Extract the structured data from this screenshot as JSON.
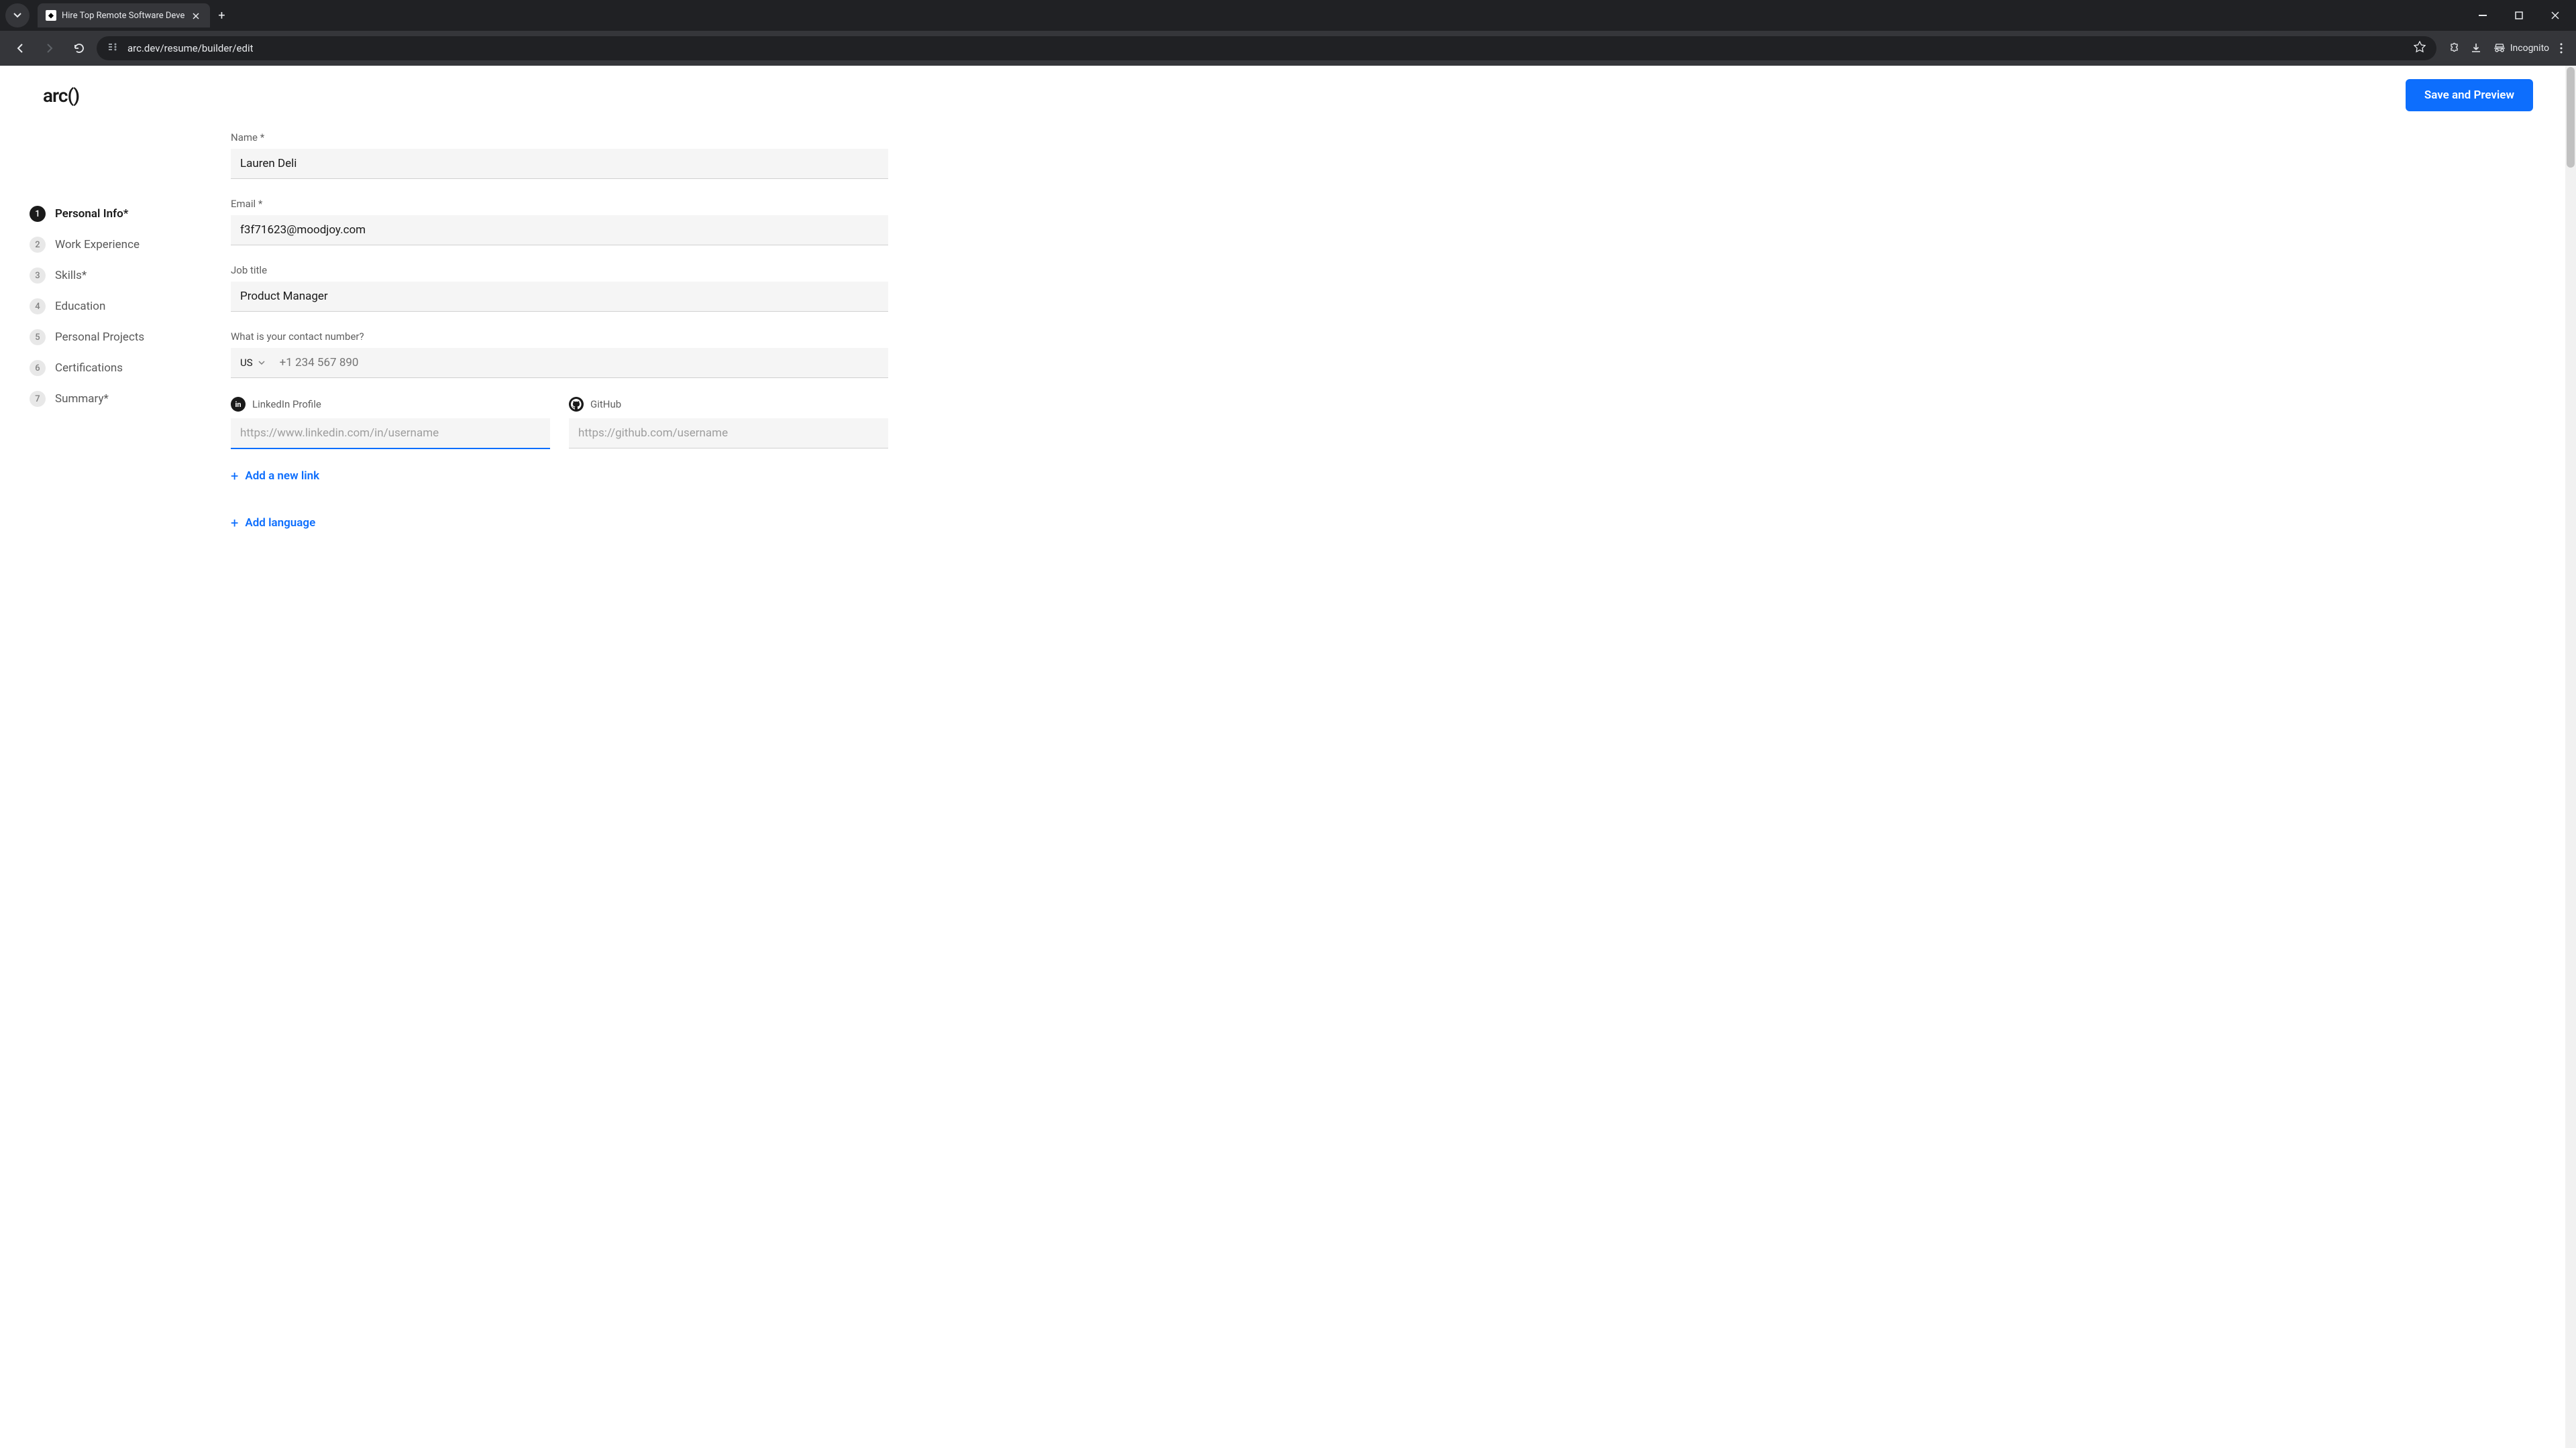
{
  "browser": {
    "tab_title": "Hire Top Remote Software Deve",
    "url": "arc.dev/resume/builder/edit",
    "incognito_label": "Incognito"
  },
  "header": {
    "logo": "arc()",
    "save_button": "Save and Preview"
  },
  "sidebar": {
    "steps": [
      {
        "num": "1",
        "label": "Personal Info*",
        "active": true
      },
      {
        "num": "2",
        "label": "Work Experience",
        "active": false
      },
      {
        "num": "3",
        "label": "Skills*",
        "active": false
      },
      {
        "num": "4",
        "label": "Education",
        "active": false
      },
      {
        "num": "5",
        "label": "Personal Projects",
        "active": false
      },
      {
        "num": "6",
        "label": "Certifications",
        "active": false
      },
      {
        "num": "7",
        "label": "Summary*",
        "active": false
      }
    ]
  },
  "form": {
    "name_label": "Name *",
    "name_value": "Lauren Deli",
    "email_label": "Email *",
    "email_value": "f3f71623@moodjoy.com",
    "jobtitle_label": "Job title",
    "jobtitle_value": "Product Manager",
    "phone_label": "What is your contact number?",
    "phone_country": "US",
    "phone_placeholder": "+1 234 567 890",
    "linkedin_label": "LinkedIn Profile",
    "linkedin_placeholder": "https://www.linkedin.com/in/username",
    "github_label": "GitHub",
    "github_placeholder": "https://github.com/username",
    "add_link": "Add a new link",
    "add_language": "Add language"
  }
}
